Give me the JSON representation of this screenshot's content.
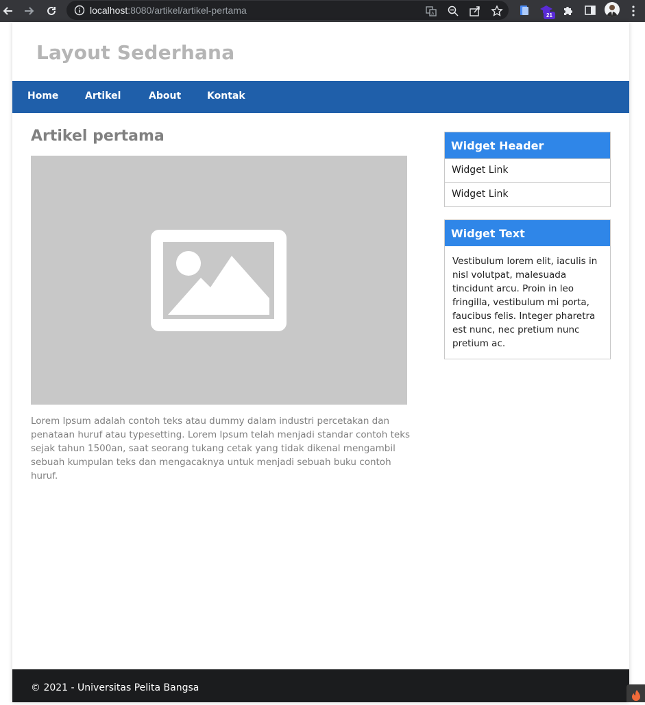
{
  "browser": {
    "url_host": "localhost",
    "url_rest": ":8080/artikel/artikel-pertama",
    "extension_badge": "21"
  },
  "site": {
    "title": "Layout Sederhana"
  },
  "nav": {
    "items": [
      {
        "label": "Home"
      },
      {
        "label": "Artikel"
      },
      {
        "label": "About"
      },
      {
        "label": "Kontak"
      }
    ]
  },
  "article": {
    "title": "Artikel pertama",
    "body": "Lorem Ipsum adalah contoh teks atau dummy dalam industri percetakan dan penataan huruf atau typesetting. Lorem Ipsum telah menjadi standar contoh teks sejak tahun 1500an, saat seorang tukang cetak yang tidak dikenal mengambil sebuah kumpulan teks dan mengacaknya untuk menjadi sebuah buku contoh huruf."
  },
  "sidebar": {
    "widget_links": {
      "header": "Widget Header",
      "links": [
        {
          "label": "Widget Link"
        },
        {
          "label": "Widget Link"
        }
      ]
    },
    "widget_text": {
      "header": "Widget Text",
      "text": "Vestibulum lorem elit, iaculis in nisl volutpat, malesuada tincidunt arcu. Proin in leo fringilla, vestibulum mi porta, faucibus felis. Integer pharetra est nunc, nec pretium nunc pretium ac."
    }
  },
  "footer": {
    "text": "© 2021 - Universitas Pelita Bangsa"
  },
  "colors": {
    "navbar": "#1f5faa",
    "widget_header": "#2f86e8",
    "footer": "#1b1c1e",
    "title_gray": "#b5b5b5"
  }
}
